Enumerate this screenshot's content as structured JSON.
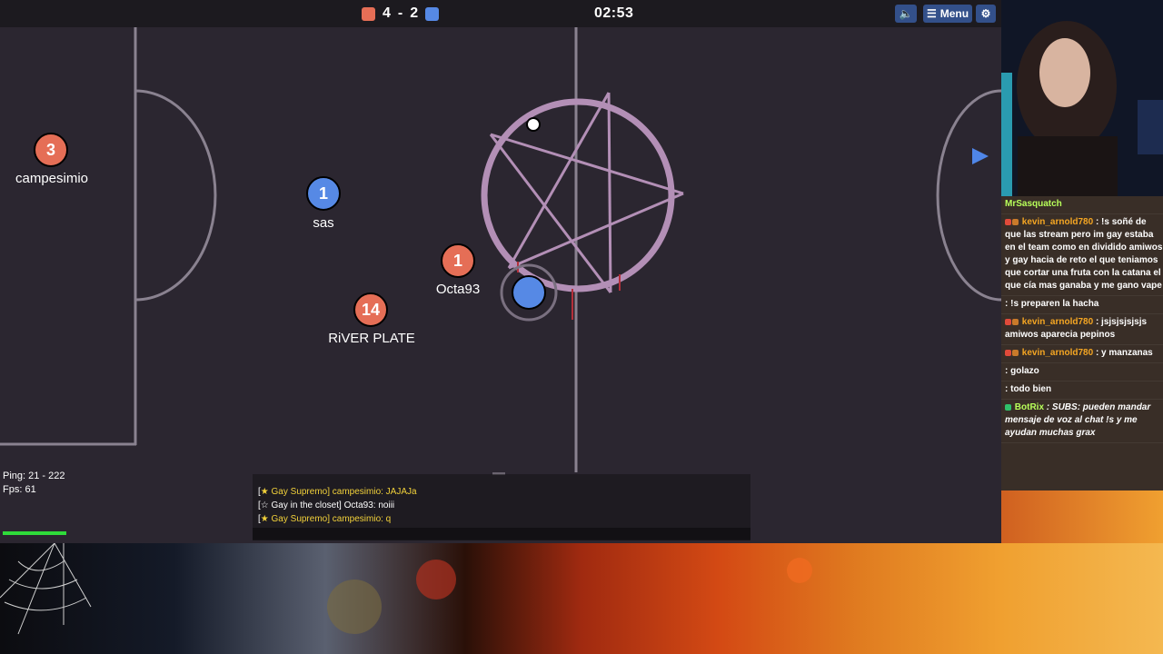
{
  "game": {
    "score": {
      "red": "4",
      "separator": "-",
      "blue": "2"
    },
    "timer": "02:53",
    "menu_label": "Menu",
    "colors": {
      "red": "#e56e56",
      "blue": "#5689e5",
      "field": "#2b2630",
      "lines": "#8a8290"
    },
    "players": [
      {
        "number": "3",
        "name": "campesimio",
        "team": "red"
      },
      {
        "number": "1",
        "name": "sas",
        "team": "blue"
      },
      {
        "number": "1",
        "name": "Octa93",
        "team": "red"
      },
      {
        "number": "14",
        "name": "RiVER PLATE",
        "team": "red"
      }
    ],
    "ping": "Ping: 21 - 222",
    "fps": "Fps: 61",
    "chat": [
      {
        "prefix": "[",
        "tag": "★ Gay Supremo] campesimio: JAJAJa",
        "color": "#f2d13a"
      },
      {
        "prefix": "[",
        "tag": "☆ Gay in the closet] Octa93: noiii",
        "color": "#ffffff"
      },
      {
        "prefix": "[",
        "tag": "★ Gay Supremo] campesimio: q",
        "color": "#f2d13a"
      }
    ]
  },
  "stream_chat": [
    {
      "user": "MrSasquatch",
      "text": "",
      "color": "#b8ff5a"
    },
    {
      "user": "kevin_arnold780",
      "text": ": !s soñé de que las stream pero im gay estaba en el team como en dividido amiwos y gay hacia de reto el que teniamos que cortar una fruta con la catana el que cía mas ganaba y me gano vape",
      "color": "#f5a623"
    },
    {
      "user": "",
      "text": ": !s preparen la hacha",
      "color": "#e0443a"
    },
    {
      "user": "kevin_arnold780",
      "text": ": jsjsjsjsjsjs amiwos aparecia pepinos",
      "color": "#f5a623"
    },
    {
      "user": "kevin_arnold780",
      "text": ": y manzanas",
      "color": "#f5a623"
    },
    {
      "user": "",
      "text": ": golazo",
      "color": "#a64ee0"
    },
    {
      "user": "",
      "text": ": todo bien",
      "color": "#a64ee0"
    },
    {
      "user": "BotRix",
      "text": ": SUBS: pueden mandar mensaje de voz al chat !s y me ayudan muchas grax",
      "color": "#b8ff5a"
    }
  ]
}
